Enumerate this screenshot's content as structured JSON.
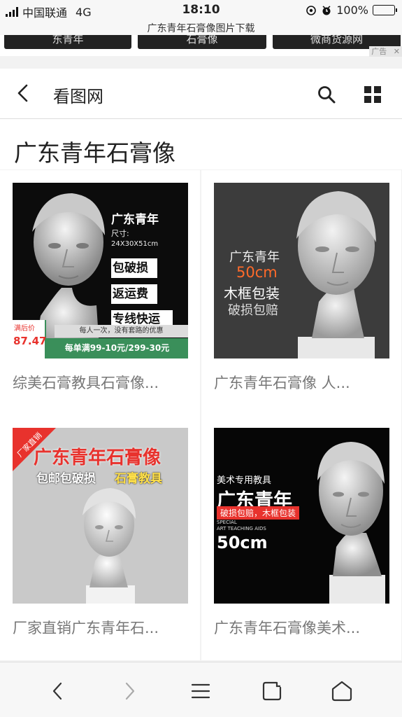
{
  "status_bar": {
    "carrier": "中国联通",
    "network": "4G",
    "time": "18:10",
    "battery": "100%",
    "battery_level": 1.0
  },
  "browser": {
    "page_title": "广东青年石膏像图片下载"
  },
  "ad_strip": {
    "thumbs": [
      "东青年",
      "石膏像",
      "微商货源网"
    ],
    "ad_label": "广告",
    "close_label": "✕"
  },
  "nav": {
    "site_name": "看图网"
  },
  "heading": "广东青年石膏像",
  "cards": [
    {
      "caption": "综美石膏教具石膏像...",
      "img": {
        "title": "广东青年",
        "size_label": "尺寸:",
        "size": "24X30X51cm",
        "badge1": "包破损",
        "badge2": "返运费",
        "badge3": "专线快运",
        "strap": "每人一次，没有套路的优惠",
        "price_label": "满后价",
        "price": "87.47",
        "promo": "每单满99-10元/299-30元"
      }
    },
    {
      "caption": "广东青年石膏像 人...",
      "img": {
        "line1": "广东青年",
        "line2": "50cm",
        "line3": "木框包装",
        "line4": "破损包赔"
      }
    },
    {
      "caption": "厂家直销广东青年石...",
      "img": {
        "corner": "厂家直销",
        "title": "广东青年石膏像",
        "sub1": "包邮包破损",
        "sub2": "石膏教具"
      }
    },
    {
      "caption": "广东青年石膏像美术...",
      "img": {
        "tag": "美术专用教具",
        "title": "广东青年",
        "red_strip": "破损包赔，木框包装",
        "en1": "SPECIAL",
        "en2": "ART TEACHING AIDS",
        "size": "50cm"
      }
    }
  ],
  "colors": {
    "accent_red": "#e8322d",
    "price_green": "#3a8f5a",
    "battery_green": "#35c94a"
  }
}
